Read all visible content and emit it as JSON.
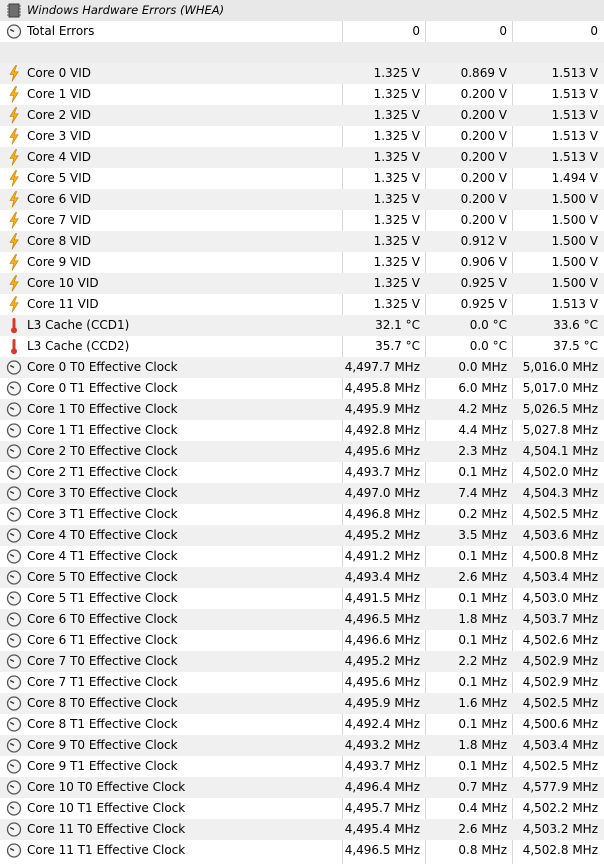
{
  "sections": {
    "whea_title": "Windows Hardware Errors (WHEA)",
    "total_errors": {
      "label": "Total Errors",
      "v1": "0",
      "v2": "0",
      "v3": "0"
    }
  },
  "rows": [
    {
      "label": "Core 0 VID",
      "icon": "bolt-icon",
      "v1": "1.325 V",
      "v2": "0.869 V",
      "v3": "1.513 V"
    },
    {
      "label": "Core 1 VID",
      "icon": "bolt-icon",
      "v1": "1.325 V",
      "v2": "0.200 V",
      "v3": "1.513 V"
    },
    {
      "label": "Core 2 VID",
      "icon": "bolt-icon",
      "v1": "1.325 V",
      "v2": "0.200 V",
      "v3": "1.513 V"
    },
    {
      "label": "Core 3 VID",
      "icon": "bolt-icon",
      "v1": "1.325 V",
      "v2": "0.200 V",
      "v3": "1.513 V"
    },
    {
      "label": "Core 4 VID",
      "icon": "bolt-icon",
      "v1": "1.325 V",
      "v2": "0.200 V",
      "v3": "1.513 V"
    },
    {
      "label": "Core 5 VID",
      "icon": "bolt-icon",
      "v1": "1.325 V",
      "v2": "0.200 V",
      "v3": "1.494 V"
    },
    {
      "label": "Core 6 VID",
      "icon": "bolt-icon",
      "v1": "1.325 V",
      "v2": "0.200 V",
      "v3": "1.500 V"
    },
    {
      "label": "Core 7 VID",
      "icon": "bolt-icon",
      "v1": "1.325 V",
      "v2": "0.200 V",
      "v3": "1.500 V"
    },
    {
      "label": "Core 8 VID",
      "icon": "bolt-icon",
      "v1": "1.325 V",
      "v2": "0.912 V",
      "v3": "1.500 V"
    },
    {
      "label": "Core 9 VID",
      "icon": "bolt-icon",
      "v1": "1.325 V",
      "v2": "0.906 V",
      "v3": "1.500 V"
    },
    {
      "label": "Core 10 VID",
      "icon": "bolt-icon",
      "v1": "1.325 V",
      "v2": "0.925 V",
      "v3": "1.500 V"
    },
    {
      "label": "Core 11 VID",
      "icon": "bolt-icon",
      "v1": "1.325 V",
      "v2": "0.925 V",
      "v3": "1.513 V"
    },
    {
      "label": "L3 Cache (CCD1)",
      "icon": "thermometer-icon",
      "v1": "32.1 °C",
      "v2": "0.0 °C",
      "v3": "33.6 °C"
    },
    {
      "label": "L3 Cache (CCD2)",
      "icon": "thermometer-icon",
      "v1": "35.7 °C",
      "v2": "0.0 °C",
      "v3": "37.5 °C"
    },
    {
      "label": "Core 0 T0 Effective Clock",
      "icon": "gauge-icon",
      "v1": "4,497.7 MHz",
      "v2": "0.0 MHz",
      "v3": "5,016.0 MHz"
    },
    {
      "label": "Core 0 T1 Effective Clock",
      "icon": "gauge-icon",
      "v1": "4,495.8 MHz",
      "v2": "6.0 MHz",
      "v3": "5,017.0 MHz"
    },
    {
      "label": "Core 1 T0 Effective Clock",
      "icon": "gauge-icon",
      "v1": "4,495.9 MHz",
      "v2": "4.2 MHz",
      "v3": "5,026.5 MHz"
    },
    {
      "label": "Core 1 T1 Effective Clock",
      "icon": "gauge-icon",
      "v1": "4,492.8 MHz",
      "v2": "4.4 MHz",
      "v3": "5,027.8 MHz"
    },
    {
      "label": "Core 2 T0 Effective Clock",
      "icon": "gauge-icon",
      "v1": "4,495.6 MHz",
      "v2": "2.3 MHz",
      "v3": "4,504.1 MHz"
    },
    {
      "label": "Core 2 T1 Effective Clock",
      "icon": "gauge-icon",
      "v1": "4,493.7 MHz",
      "v2": "0.1 MHz",
      "v3": "4,502.0 MHz"
    },
    {
      "label": "Core 3 T0 Effective Clock",
      "icon": "gauge-icon",
      "v1": "4,497.0 MHz",
      "v2": "7.4 MHz",
      "v3": "4,504.3 MHz"
    },
    {
      "label": "Core 3 T1 Effective Clock",
      "icon": "gauge-icon",
      "v1": "4,496.8 MHz",
      "v2": "0.2 MHz",
      "v3": "4,502.5 MHz"
    },
    {
      "label": "Core 4 T0 Effective Clock",
      "icon": "gauge-icon",
      "v1": "4,495.2 MHz",
      "v2": "3.5 MHz",
      "v3": "4,503.6 MHz"
    },
    {
      "label": "Core 4 T1 Effective Clock",
      "icon": "gauge-icon",
      "v1": "4,491.2 MHz",
      "v2": "0.1 MHz",
      "v3": "4,500.8 MHz"
    },
    {
      "label": "Core 5 T0 Effective Clock",
      "icon": "gauge-icon",
      "v1": "4,493.4 MHz",
      "v2": "2.6 MHz",
      "v3": "4,503.4 MHz"
    },
    {
      "label": "Core 5 T1 Effective Clock",
      "icon": "gauge-icon",
      "v1": "4,491.5 MHz",
      "v2": "0.1 MHz",
      "v3": "4,503.0 MHz"
    },
    {
      "label": "Core 6 T0 Effective Clock",
      "icon": "gauge-icon",
      "v1": "4,496.5 MHz",
      "v2": "1.8 MHz",
      "v3": "4,503.7 MHz"
    },
    {
      "label": "Core 6 T1 Effective Clock",
      "icon": "gauge-icon",
      "v1": "4,496.6 MHz",
      "v2": "0.1 MHz",
      "v3": "4,502.6 MHz"
    },
    {
      "label": "Core 7 T0 Effective Clock",
      "icon": "gauge-icon",
      "v1": "4,495.2 MHz",
      "v2": "2.2 MHz",
      "v3": "4,502.9 MHz"
    },
    {
      "label": "Core 7 T1 Effective Clock",
      "icon": "gauge-icon",
      "v1": "4,495.6 MHz",
      "v2": "0.1 MHz",
      "v3": "4,502.9 MHz"
    },
    {
      "label": "Core 8 T0 Effective Clock",
      "icon": "gauge-icon",
      "v1": "4,495.9 MHz",
      "v2": "1.6 MHz",
      "v3": "4,502.5 MHz"
    },
    {
      "label": "Core 8 T1 Effective Clock",
      "icon": "gauge-icon",
      "v1": "4,492.4 MHz",
      "v2": "0.1 MHz",
      "v3": "4,500.6 MHz"
    },
    {
      "label": "Core 9 T0 Effective Clock",
      "icon": "gauge-icon",
      "v1": "4,493.2 MHz",
      "v2": "1.8 MHz",
      "v3": "4,503.4 MHz"
    },
    {
      "label": "Core 9 T1 Effective Clock",
      "icon": "gauge-icon",
      "v1": "4,493.7 MHz",
      "v2": "0.1 MHz",
      "v3": "4,502.5 MHz"
    },
    {
      "label": "Core 10 T0 Effective Clock",
      "icon": "gauge-icon",
      "v1": "4,496.4 MHz",
      "v2": "0.7 MHz",
      "v3": "4,577.9 MHz"
    },
    {
      "label": "Core 10 T1 Effective Clock",
      "icon": "gauge-icon",
      "v1": "4,495.7 MHz",
      "v2": "0.4 MHz",
      "v3": "4,502.2 MHz"
    },
    {
      "label": "Core 11 T0 Effective Clock",
      "icon": "gauge-icon",
      "v1": "4,495.4 MHz",
      "v2": "2.6 MHz",
      "v3": "4,503.2 MHz"
    },
    {
      "label": "Core 11 T1 Effective Clock",
      "icon": "gauge-icon",
      "v1": "4,496.5 MHz",
      "v2": "0.8 MHz",
      "v3": "4,502.8 MHz"
    }
  ]
}
